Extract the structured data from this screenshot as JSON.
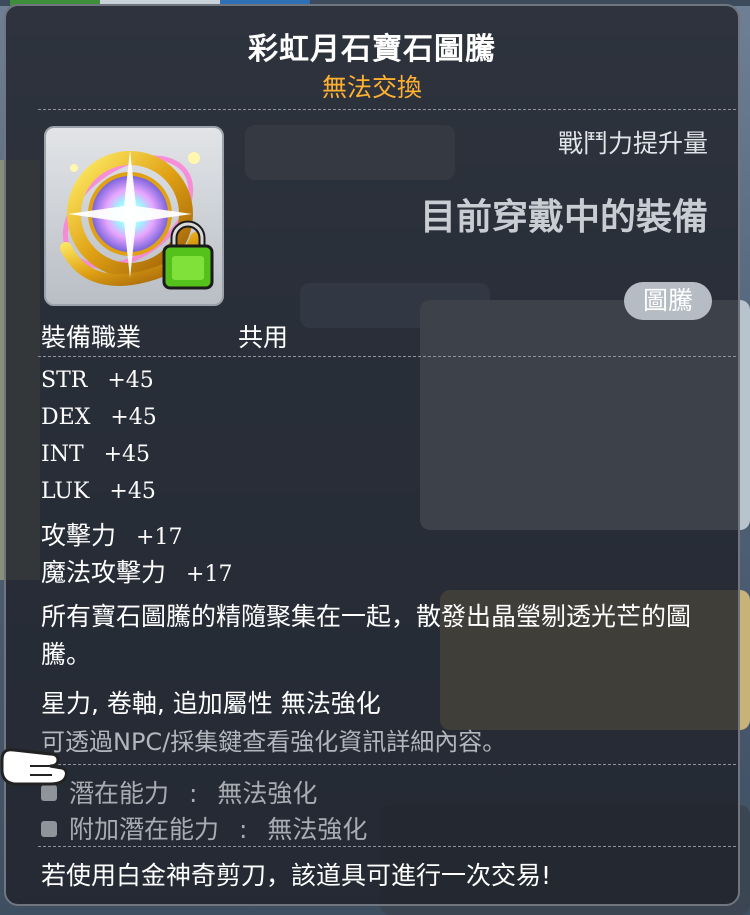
{
  "item": {
    "name": "彩虹月石寶石圖騰",
    "trade_status": "無法交換",
    "combat_power_label": "戰鬥力提升量",
    "combat_power_value": "目前穿戴中的裝備",
    "type_badge": "圖騰",
    "job_label": "裝備職業",
    "job_value": "共用",
    "stats": [
      {
        "name": "STR",
        "value": "+45"
      },
      {
        "name": "DEX",
        "value": "+45"
      },
      {
        "name": "INT",
        "value": "+45"
      },
      {
        "name": "LUK",
        "value": "+45"
      },
      {
        "name": "攻擊力",
        "value": "+17"
      },
      {
        "name": "魔法攻擊力",
        "value": "+17"
      }
    ],
    "description": "所有寶石圖騰的精隨聚集在一起，散發出晶瑩剔透光芒的圖騰。",
    "enhance_note": "星力, 卷軸, 追加屬性 無法強化",
    "enhance_hint": "可透過NPC/採集鍵查看強化資訊詳細內容。",
    "potential": {
      "label": "潛在能力",
      "sep": ":",
      "value": "無法強化"
    },
    "bonus_potential": {
      "label": "附加潛在能力",
      "sep": ":",
      "value": "無法強化"
    },
    "footer": "若使用白金神奇剪刀，該道具可進行一次交易!",
    "lock_icon": "lock-icon",
    "colors": {
      "title": "#ffffff",
      "trade": "#ffb031",
      "muted": "#a9adb3"
    }
  }
}
